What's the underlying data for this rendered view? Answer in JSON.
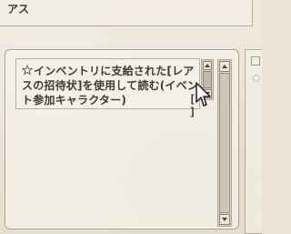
{
  "top_panel": {
    "text": "アス"
  },
  "main_panel": {
    "description": "インベントリに支給された[レアスの招待状]を使用して読む(イベント参加キャラクター)",
    "bracket_fragment": "[ ]"
  },
  "icons": {
    "star": "star-icon",
    "cursor": "mouse-pointer-icon"
  }
}
